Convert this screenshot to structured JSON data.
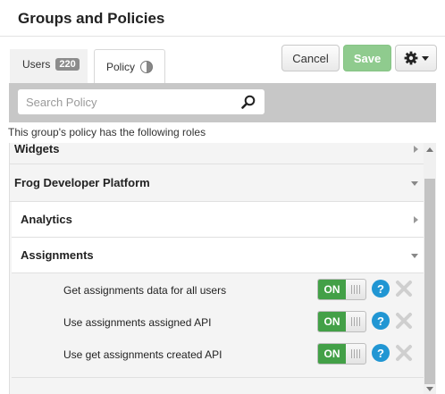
{
  "header": {
    "title": "Groups and Policies"
  },
  "tabs": {
    "users": {
      "label": "Users",
      "count": "220"
    },
    "policy": {
      "label": "Policy",
      "icon": "half-circle-icon"
    }
  },
  "toolbar": {
    "cancel_label": "Cancel",
    "save_label": "Save",
    "settings_icon": "gear-icon",
    "save_color": "#8fcb8e",
    "toggle_on_color": "#43a047",
    "help_color": "#2196d3"
  },
  "search": {
    "placeholder": "Search Policy",
    "value": ""
  },
  "policy": {
    "subtitle": "This group's policy has the following roles",
    "sections": [
      {
        "label": "Widgets",
        "state": "collapsed"
      },
      {
        "label": "Frog Developer Platform",
        "state": "expanded"
      },
      {
        "label": "Analytics",
        "state": "collapsed"
      },
      {
        "label": "Assignments",
        "state": "expanded"
      }
    ],
    "roles": [
      {
        "label": "Get assignments data for all users",
        "toggle": "ON"
      },
      {
        "label": "Use assignments assigned API",
        "toggle": "ON"
      },
      {
        "label": "Use get assignments created API",
        "toggle": "ON"
      }
    ]
  }
}
